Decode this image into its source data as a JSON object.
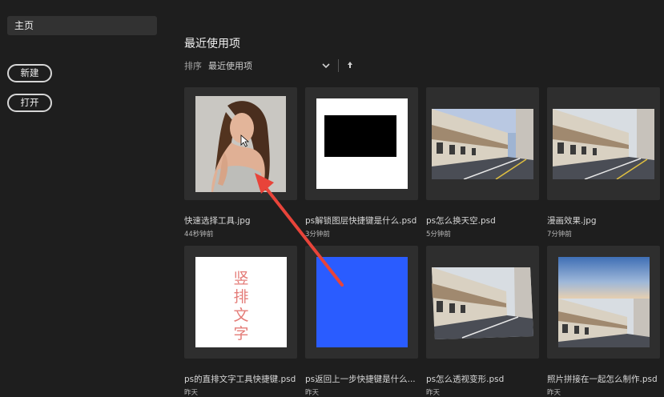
{
  "sidebar": {
    "home_label": "主页",
    "new_label": "新建",
    "open_label": "打开"
  },
  "main": {
    "heading": "最近使用项",
    "sort_label": "排序",
    "sort_value": "最近使用项",
    "sort_direction_icon": "up-arrow-icon"
  },
  "files": [
    {
      "name": "快速选择工具.jpg",
      "time": "44秒钟前",
      "thumb": "portrait-photo"
    },
    {
      "name": "ps解锁图层快捷键是什么.psd",
      "time": "3分钟前",
      "thumb": "black-rectangle"
    },
    {
      "name": "ps怎么换天空.psd",
      "time": "5分钟前",
      "thumb": "street-photo"
    },
    {
      "name": "漫画效果.jpg",
      "time": "7分钟前",
      "thumb": "street-photo"
    },
    {
      "name": "ps的直排文字工具快捷键.psd",
      "time": "昨天",
      "thumb": "vertical-text",
      "thumb_text": "竖排文字"
    },
    {
      "name": "ps返回上一步快捷键是什么...",
      "time": "昨天",
      "thumb": "blue-square"
    },
    {
      "name": "ps怎么透视变形.psd",
      "time": "昨天",
      "thumb": "street-photo-skewed"
    },
    {
      "name": "照片拼接在一起怎么制作.psd",
      "time": "昨天",
      "thumb": "sky-street-collage"
    }
  ],
  "colors": {
    "background": "#1e1e1e",
    "card": "#2e2e2e",
    "annotation_arrow": "#e8443a",
    "blue_thumb": "#2a5cff",
    "vertical_text": "#e47c78"
  }
}
